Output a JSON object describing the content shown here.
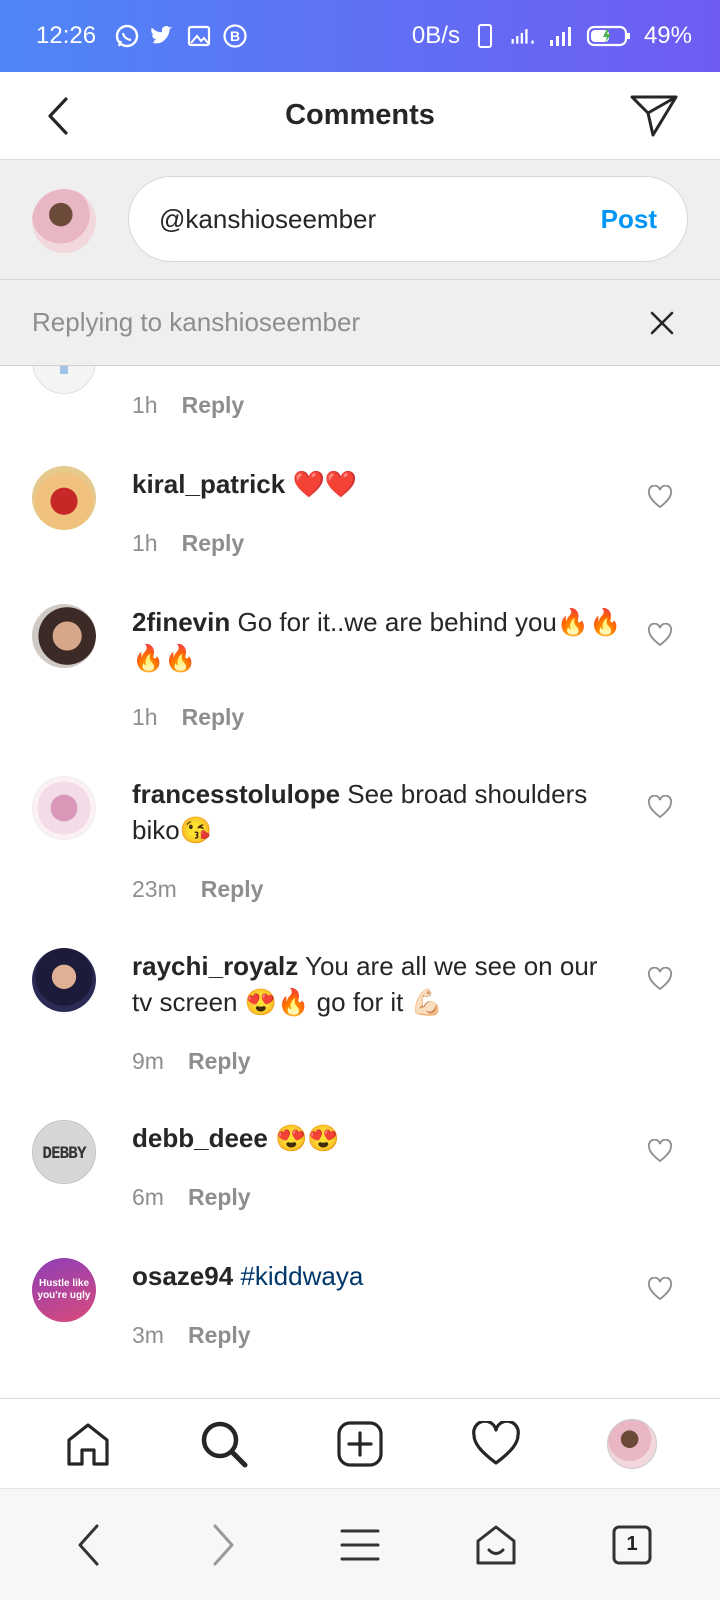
{
  "status_bar": {
    "time": "12:26",
    "network_speed": "0B/s",
    "battery": "49%"
  },
  "header": {
    "title": "Comments"
  },
  "composer": {
    "input_value": "@kanshioseember",
    "post_label": "Post"
  },
  "replying": {
    "text": "Replying to kanshioseember"
  },
  "comments": [
    {
      "username": "",
      "text": "",
      "time": "1h",
      "reply_label": "Reply"
    },
    {
      "username": "kiral_patrick",
      "text": "❤️❤️",
      "time": "1h",
      "reply_label": "Reply"
    },
    {
      "username": "2finevin",
      "text": "Go for it..we are behind you🔥🔥🔥🔥",
      "time": "1h",
      "reply_label": "Reply"
    },
    {
      "username": "francesstolulope",
      "text": "See broad shoulders biko😘",
      "time": "23m",
      "reply_label": "Reply"
    },
    {
      "username": "raychi_royalz",
      "text": "You are all we see on our tv screen 😍🔥 go for it 💪🏻",
      "time": "9m",
      "reply_label": "Reply"
    },
    {
      "username": "debb_deee",
      "text": "😍😍",
      "time": "6m",
      "reply_label": "Reply"
    },
    {
      "username": "osaze94",
      "text": "#kiddwaya",
      "time": "3m",
      "reply_label": "Reply"
    }
  ],
  "avatars": {
    "debby_text": "DEBBY",
    "osaze_line1": "Hustle like",
    "osaze_line2": "you're ugly"
  },
  "system_nav": {
    "tab_count": "1"
  },
  "colors": {
    "accent": "#0095f6",
    "hashtag": "#00376b",
    "statusbar_start": "#4f86f7",
    "statusbar_end": "#6f5cf3"
  }
}
